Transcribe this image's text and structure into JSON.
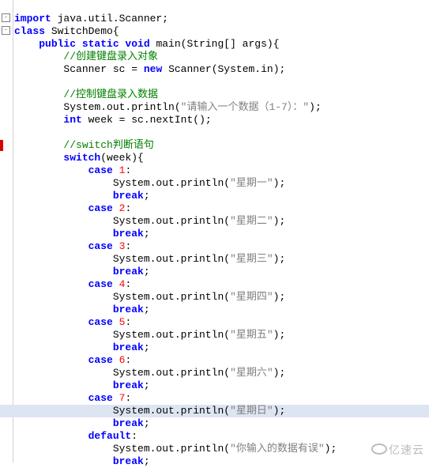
{
  "code": {
    "l1_import": "import",
    "l1_pkg": " java.util.Scanner",
    "l2_class": "class",
    "l2_name": " SwitchDemo",
    "l3_mods": "public static void",
    "l3_main": " main",
    "l3_sig": "(String[] args)",
    "c1": "//创建键盘录入对象",
    "l5_a": "Scanner sc ",
    "l5_eq": "=",
    "l5_new": " new",
    "l5_b": " Scanner(System.in)",
    "c2": "//控制键盘录入数据",
    "l8_a": "System.out.println(",
    "l8_s": "\"请输入一个数据（1-7）：\"",
    "l8_b": ")",
    "l9_int": "int",
    "l9_a": " week ",
    "l9_eq": "=",
    "l9_b": " sc.nextInt()",
    "c3": "//switch判断语句",
    "l12_switch": "switch",
    "l12_a": "(week)",
    "case": "case",
    "n1": "1",
    "n2": "2",
    "n3": "3",
    "n4": "4",
    "n5": "5",
    "n6": "6",
    "n7": "7",
    "sop": "System.out.println(",
    "close_paren": ")",
    "s1": "\"星期一\"",
    "s2": "\"星期二\"",
    "s3": "\"星期三\"",
    "s4": "\"星期四\"",
    "s5": "\"星期五\"",
    "s6": "\"星期六\"",
    "s7": "\"星期日\"",
    "s8": "\"你输入的数据有误\"",
    "break": "break",
    "default": "default",
    "semi": ";",
    "colon": ":",
    "lbrace": "{",
    "rbrace": "}"
  },
  "watermark": "亿速云"
}
